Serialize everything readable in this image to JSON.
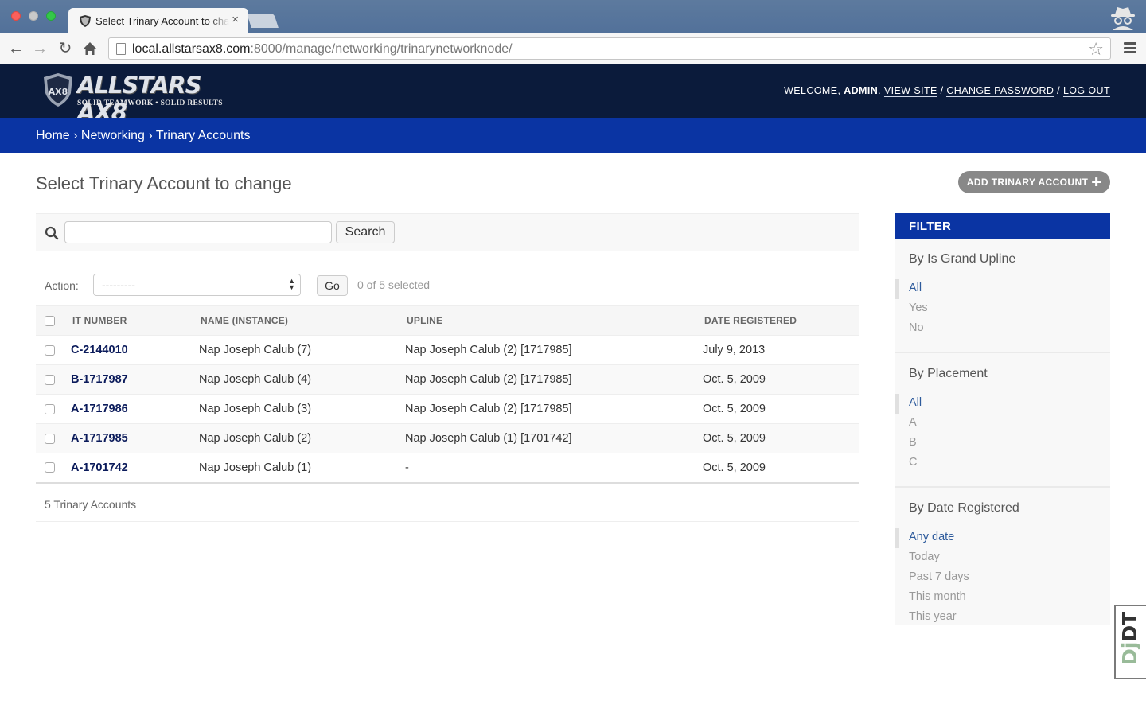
{
  "browser": {
    "tab_title": "Select Trinary Account to change",
    "url_host": "local.allstarsax8.com",
    "url_path": ":8000/manage/networking/trinarynetworknode/"
  },
  "header": {
    "brand": "ALLSTARS AX8",
    "tagline": "SOLID TEAMWORK • SOLID RESULTS",
    "welcome": "WELCOME,",
    "username": "ADMIN",
    "view_site": "VIEW SITE",
    "change_password": "CHANGE PASSWORD",
    "log_out": "LOG OUT"
  },
  "breadcrumbs": [
    "Home",
    "Networking",
    "Trinary Accounts"
  ],
  "page": {
    "title": "Select Trinary Account to change",
    "add_button": "ADD TRINARY ACCOUNT"
  },
  "search": {
    "value": "",
    "button": "Search"
  },
  "actions": {
    "label": "Action:",
    "selected": "---------",
    "go": "Go",
    "counter": "0 of 5 selected"
  },
  "table": {
    "headers": [
      "IT NUMBER",
      "NAME (INSTANCE)",
      "UPLINE",
      "DATE REGISTERED"
    ],
    "rows": [
      {
        "it": "C-2144010",
        "name": "Nap Joseph Calub (7)",
        "upline": "Nap Joseph Calub (2) [1717985]",
        "date": "July 9, 2013"
      },
      {
        "it": "B-1717987",
        "name": "Nap Joseph Calub (4)",
        "upline": "Nap Joseph Calub (2) [1717985]",
        "date": "Oct. 5, 2009"
      },
      {
        "it": "A-1717986",
        "name": "Nap Joseph Calub (3)",
        "upline": "Nap Joseph Calub (2) [1717985]",
        "date": "Oct. 5, 2009"
      },
      {
        "it": "A-1717985",
        "name": "Nap Joseph Calub (2)",
        "upline": "Nap Joseph Calub (1) [1701742]",
        "date": "Oct. 5, 2009"
      },
      {
        "it": "A-1701742",
        "name": "Nap Joseph Calub (1)",
        "upline": "-",
        "date": "Oct. 5, 2009"
      }
    ],
    "count_text": "5 Trinary Accounts"
  },
  "filter": {
    "title": "FILTER",
    "groups": [
      {
        "title": "By Is Grand Upline",
        "options": [
          "All",
          "Yes",
          "No"
        ]
      },
      {
        "title": "By Placement",
        "options": [
          "All",
          "A",
          "B",
          "C"
        ]
      },
      {
        "title": "By Date Registered",
        "options": [
          "Any date",
          "Today",
          "Past 7 days",
          "This month",
          "This year"
        ]
      }
    ]
  },
  "debug_toolbar": {
    "label_prefix": "Dj",
    "label_suffix": "DT"
  },
  "colors": {
    "header_bg": "#0b1b3b",
    "breadcrumb_bg": "#0a34a3",
    "link": "#0b1b5b"
  }
}
